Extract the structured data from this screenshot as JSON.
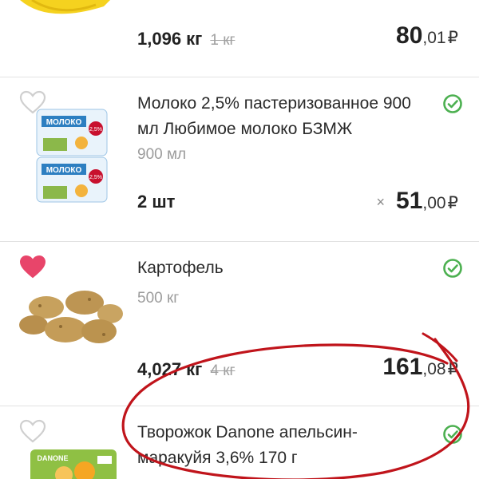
{
  "items": [
    {
      "id": "bananas",
      "qty": "1,096 кг",
      "qty_old": "1 кг",
      "price_main": "80",
      "price_cents": ",01",
      "currency": "₽"
    },
    {
      "id": "milk",
      "name": "Молоко 2,5% пастеризованное 900 мл Любимое молоко БЗМЖ",
      "volume": "900 мл",
      "qty": "2 шт",
      "times": "×",
      "price_main": "51",
      "price_cents": ",00",
      "currency": "₽",
      "package_text": "МОЛОКО",
      "package_percent": "2,5%",
      "favorite": false
    },
    {
      "id": "potato",
      "name": "Картофель",
      "volume": "500 кг",
      "qty": "4,027 кг",
      "qty_old": "4 кг",
      "price_main": "161",
      "price_cents": ",08",
      "currency": "₽",
      "favorite": true
    },
    {
      "id": "curd",
      "name": "Творожок Danone апельсин-маракуйя 3,6% 170 г",
      "package_text": "DANONE",
      "favorite": false
    }
  ],
  "colors": {
    "check": "#4cb050",
    "heart_active": "#e8456a",
    "heart_inactive": "#cfcfcf",
    "annotation": "#c0141b",
    "banana": "#f5d21f"
  },
  "icons": [
    "heart-icon",
    "check-circle-icon"
  ]
}
